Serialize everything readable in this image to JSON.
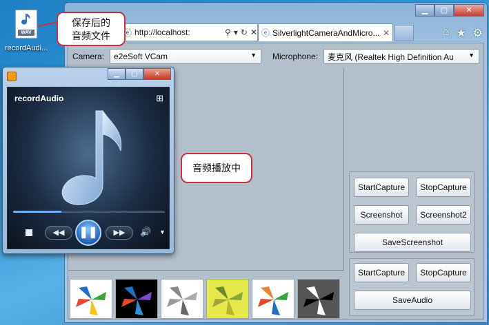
{
  "desktop": {
    "file_icon_label": "WAV",
    "file_name": "recordAudi..."
  },
  "callouts": {
    "saved_line1": "保存后的",
    "saved_line2": "音频文件",
    "playing": "音频播放中"
  },
  "browser": {
    "address_url": "http://localhost:",
    "tab_title": "SilverlightCameraAndMicro...",
    "icons": [
      "search-icon",
      "refresh-icon",
      "home-icon",
      "star-icon",
      "gear-icon"
    ]
  },
  "app": {
    "camera_label": "Camera:",
    "camera_value": "e2eSoft VCam",
    "microphone_label": "Microphone:",
    "microphone_value": "麦克风 (Realtek High Definition Au",
    "video_buttons": {
      "start_capture": "StartCapture",
      "stop_capture": "StopCapture",
      "screenshot": "Screenshot",
      "screenshot2": "Screenshot2",
      "save_screenshot": "SaveScreenshot"
    },
    "audio_buttons": {
      "start_capture": "StartCapture",
      "stop_capture": "StopCapture",
      "save_audio": "SaveAudio"
    }
  },
  "player": {
    "title": "recordAudio",
    "progress_fraction": 0.32
  }
}
